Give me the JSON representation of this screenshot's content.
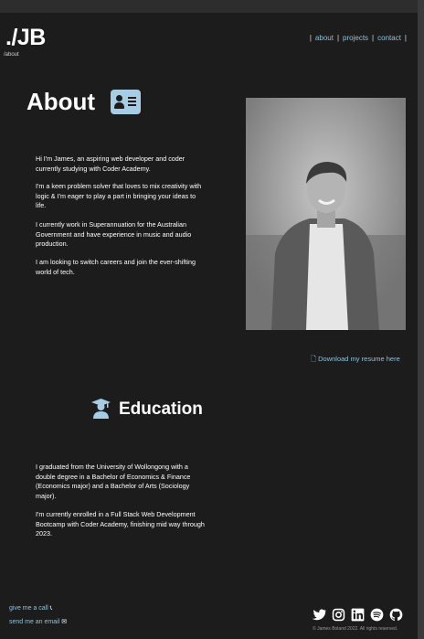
{
  "header": {
    "logo": "./JB",
    "path": "/about",
    "nav": [
      "about",
      "projects",
      "contact"
    ],
    "separator": "|"
  },
  "about": {
    "heading": "About",
    "paragraphs": [
      "Hi I'm James, an aspiring web developer and coder currently studying with Coder Academy.",
      "I'm a keen problem solver that loves to mix creativity with logic & I'm eager to play a part in bringing your ideas to life.",
      "I currently work in Superannuation for the Australian Government and have experience in music and audio production.",
      "I am looking to switch careers and join the ever-shifting world of tech."
    ],
    "resume_label": "Download my resume here"
  },
  "education": {
    "heading": "Education",
    "paragraphs": [
      "I graduated from the University of Wollongong with a double degree in a Bachelor of Economics & Finance (Economics major) and a Bachelor of Arts (Sociology major).",
      "I'm currently enrolled in a Full Stack Web Development Bootcamp with Coder Academy, finishing mid way through 2023."
    ]
  },
  "footer": {
    "call_label": "give me a call",
    "email_label": "send me an email",
    "copyright": "© James Boland 2022. All rights reserved.",
    "socials": [
      "twitter-icon",
      "instagram-icon",
      "linkedin-icon",
      "spotify-icon",
      "github-icon"
    ]
  },
  "colors": {
    "accent": "#8fc1de",
    "background": "#1c1c1c",
    "icon_fill": "#a6cde3"
  }
}
